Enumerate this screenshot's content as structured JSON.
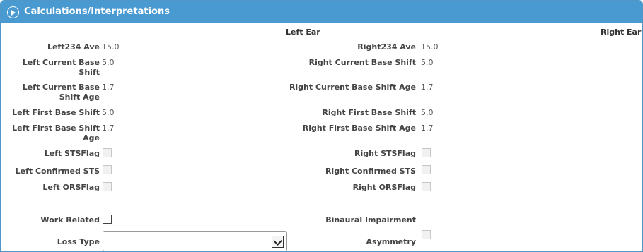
{
  "panel": {
    "title": "Calculations/Interpretations"
  },
  "left_ear": {
    "heading": "Left Ear",
    "ave_label": "Left234 Ave",
    "ave_value": "15.0",
    "cbs_label": "Left Current Base Shift",
    "cbs_value": "5.0",
    "cbs_age_label": "Left Current Base Shift Age",
    "cbs_age_value": "1.7",
    "fbs_label": "Left First Base Shift",
    "fbs_value": "5.0",
    "fbs_age_label": "Left First Base Shift Age",
    "fbs_age_value": "1.7",
    "sts_flag_label": "Left STSFlag",
    "sts_flag_checked": false,
    "confirmed_sts_label": "Left Confirmed STS",
    "confirmed_sts_checked": false,
    "ors_flag_label": "Left ORSFlag",
    "ors_flag_checked": false
  },
  "right_ear": {
    "heading": "Right Ear",
    "ave_label": "Right234 Ave",
    "ave_value": "15.0",
    "cbs_label": "Right Current Base Shift",
    "cbs_value": "5.0",
    "cbs_age_label": "Right Current Base Shift Age",
    "cbs_age_value": "1.7",
    "fbs_label": "Right First Base Shift",
    "fbs_value": "5.0",
    "fbs_age_label": "Right First Base Shift Age",
    "fbs_age_value": "1.7",
    "sts_flag_label": "Right STSFlag",
    "sts_flag_checked": false,
    "confirmed_sts_label": "Right Confirmed STS",
    "confirmed_sts_checked": false,
    "ors_flag_label": "Right ORSFlag",
    "ors_flag_checked": false
  },
  "general": {
    "work_related_label": "Work Related",
    "work_related_checked": false,
    "loss_type_label": "Loss Type",
    "loss_type_value": "",
    "binaural_label": "Binaural Impairment",
    "binaural_value": "",
    "asymmetry_label": "Asymmetry",
    "asymmetry_checked": false
  }
}
